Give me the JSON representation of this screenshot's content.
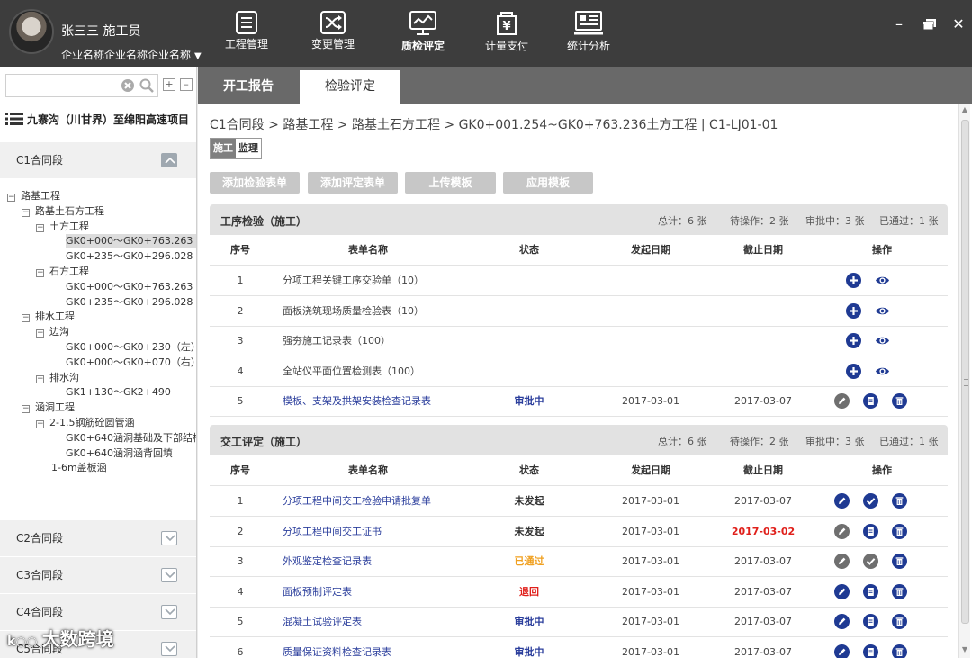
{
  "app": {
    "user_name": "张三三  施工员",
    "company": "企业名称企业名称企业名称",
    "nav": [
      {
        "label": "工程管理",
        "icon": "list-icon"
      },
      {
        "label": "变更管理",
        "icon": "shuffle-icon"
      },
      {
        "label": "质检评定",
        "icon": "monitor-chart-icon"
      },
      {
        "label": "计量支付",
        "icon": "yen-calculator-icon"
      },
      {
        "label": "统计分析",
        "icon": "statistics-screen-icon"
      }
    ],
    "active_nav": "质检评定"
  },
  "sidebar": {
    "search_placeholder": "",
    "project": "九寨沟（川甘界）至绵阳高速项目",
    "sections_top": [
      {
        "label": "C1合同段",
        "expanded": true
      }
    ],
    "tree": [
      {
        "label": "路基工程",
        "level": 0,
        "toggle": "⊟"
      },
      {
        "label": "路基土石方工程",
        "level": 1,
        "toggle": "⊟"
      },
      {
        "label": "土方工程",
        "level": 2,
        "toggle": "⊟"
      },
      {
        "label": "GK0+000～GK0+763.263",
        "level": 3,
        "toggle": "",
        "selected": true
      },
      {
        "label": "GK0+235～GK0+296.028",
        "level": 3,
        "toggle": ""
      },
      {
        "label": "石方工程",
        "level": 2,
        "toggle": "⊟"
      },
      {
        "label": "GK0+000～GK0+763.263",
        "level": 3,
        "toggle": ""
      },
      {
        "label": "GK0+235～GK0+296.028",
        "level": 3,
        "toggle": ""
      },
      {
        "label": "排水工程",
        "level": 1,
        "toggle": "⊟"
      },
      {
        "label": "边沟",
        "level": 2,
        "toggle": "⊟"
      },
      {
        "label": "GK0+000～GK0+230（左）",
        "level": 3,
        "toggle": ""
      },
      {
        "label": "GK0+000～GK0+070（右）",
        "level": 3,
        "toggle": ""
      },
      {
        "label": "排水沟",
        "level": 2,
        "toggle": "⊟"
      },
      {
        "label": "GK1+130～GK2+490",
        "level": 3,
        "toggle": ""
      },
      {
        "label": "涵洞工程",
        "level": 1,
        "toggle": "⊟"
      },
      {
        "label": "2-1.5钢筋砼圆管涵",
        "level": 2,
        "toggle": "⊟"
      },
      {
        "label": "GK0+640涵洞基础及下部结构",
        "level": 3,
        "toggle": ""
      },
      {
        "label": "GK0+640涵洞涵背回填",
        "level": 3,
        "toggle": ""
      },
      {
        "label": "1-6m盖板涵",
        "level": 2,
        "toggle": ""
      }
    ],
    "sections_bottom": [
      {
        "label": "C2合同段"
      },
      {
        "label": "C3合同段"
      },
      {
        "label": "C4合同段"
      },
      {
        "label": "C5合同段"
      }
    ],
    "watermark": "大数跨境"
  },
  "tabs": [
    {
      "label": "开工报告",
      "active": false
    },
    {
      "label": "检验评定",
      "active": true
    }
  ],
  "main": {
    "breadcrumb": "C1合同段 > 路基工程 > 路基土石方工程  > GK0+001.254~GK0+763.236土方工程 | C1-LJ01-01",
    "roles": [
      {
        "label": "施工",
        "active": true
      },
      {
        "label": "监理",
        "active": false
      }
    ],
    "actions": [
      "添加检验表单",
      "添加评定表单",
      "上传模板",
      "应用模板"
    ],
    "columns": [
      "序号",
      "表单名称",
      "状态",
      "发起日期",
      "截止日期",
      "操作"
    ],
    "panels": [
      {
        "title": "工序检验（施工）",
        "stats": [
          "总计：6 张",
          "待操作：2 张",
          "审批中：3 张",
          "已通过：1 张"
        ],
        "rows": [
          {
            "no": "1",
            "name": "分项工程关键工序交验单（10）",
            "link": false,
            "status": "",
            "status_color": "#333333",
            "start": "",
            "end": "",
            "end_color": "#444444",
            "ops": [
              "add",
              "view"
            ]
          },
          {
            "no": "2",
            "name": "面板浇筑现场质量检验表（10）",
            "link": false,
            "status": "",
            "status_color": "#333333",
            "start": "",
            "end": "",
            "end_color": "#444444",
            "ops": [
              "add",
              "view"
            ]
          },
          {
            "no": "3",
            "name": "强夯施工记录表（100）",
            "link": false,
            "status": "",
            "status_color": "#333333",
            "start": "",
            "end": "",
            "end_color": "#444444",
            "ops": [
              "add",
              "view"
            ]
          },
          {
            "no": "4",
            "name": "全站仪平面位置检测表（100）",
            "link": false,
            "status": "",
            "status_color": "#333333",
            "start": "",
            "end": "",
            "end_color": "#444444",
            "ops": [
              "add",
              "view"
            ]
          },
          {
            "no": "5",
            "name": "模板、支架及拱架安装检查记录表",
            "link": true,
            "status": "审批中",
            "status_color": "#2b3e9c",
            "start": "2017-03-01",
            "end": "2017-03-07",
            "end_color": "#444444",
            "ops": [
              "edit-gray",
              "doc",
              "trash"
            ]
          }
        ]
      },
      {
        "title": "交工评定（施工）",
        "stats": [
          "总计：6 张",
          "待操作：2 张",
          "审批中：3 张",
          "已通过：1 张"
        ],
        "rows": [
          {
            "no": "1",
            "name": "分项工程中间交工检验申请批复单",
            "link": true,
            "status": "未发起",
            "status_color": "#333333",
            "start": "2017-03-01",
            "end": "2017-03-07",
            "end_color": "#444444",
            "ops": [
              "edit",
              "check",
              "trash"
            ]
          },
          {
            "no": "2",
            "name": "分项工程中间交工证书",
            "link": true,
            "status": "未发起",
            "status_color": "#333333",
            "start": "2017-03-01",
            "end": "2017-03-02",
            "end_color": "#e0201b",
            "ops": [
              "edit-gray",
              "doc",
              "trash"
            ]
          },
          {
            "no": "3",
            "name": "外观鉴定检查记录表",
            "link": true,
            "status": "已通过",
            "status_color": "#f0a020",
            "start": "2017-03-01",
            "end": "2017-03-07",
            "end_color": "#444444",
            "ops": [
              "edit-gray",
              "check-gray",
              "trash"
            ]
          },
          {
            "no": "4",
            "name": "面板预制评定表",
            "link": true,
            "status": "退回",
            "status_color": "#e0201b",
            "start": "2017-03-01",
            "end": "2017-03-07",
            "end_color": "#444444",
            "ops": [
              "edit",
              "doc",
              "trash"
            ]
          },
          {
            "no": "5",
            "name": "混凝土试验评定表",
            "link": true,
            "status": "审批中",
            "status_color": "#2b3e9c",
            "start": "2017-03-01",
            "end": "2017-03-07",
            "end_color": "#444444",
            "ops": [
              "edit",
              "doc",
              "trash"
            ]
          },
          {
            "no": "6",
            "name": "质量保证资料检查记录表",
            "link": true,
            "status": "审批中",
            "status_color": "#2b3e9c",
            "start": "2017-03-01",
            "end": "2017-03-07",
            "end_color": "#444444",
            "ops": [
              "edit",
              "doc",
              "trash"
            ]
          }
        ]
      }
    ]
  },
  "colors": {
    "accent": "#1f3a93",
    "gray_icon": "#6f6f6f",
    "topbar": "#3d3d3d",
    "tabbar": "#696969"
  }
}
